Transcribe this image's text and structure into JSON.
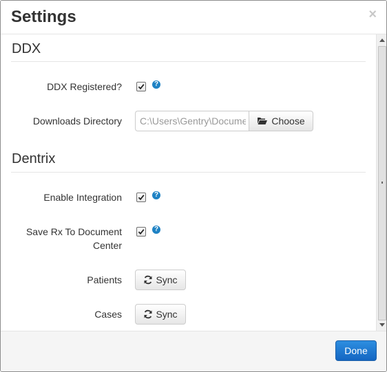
{
  "dialog": {
    "title": "Settings",
    "close_symbol": "×"
  },
  "sections": {
    "ddx": {
      "title": "DDX",
      "registered_label": "DDX Registered?",
      "registered_checked": true,
      "downloads_label": "Downloads Directory",
      "downloads_value": "C:\\Users\\Gentry\\Documents",
      "choose_label": "Choose"
    },
    "dentrix": {
      "title": "Dentrix",
      "enable_label": "Enable Integration",
      "enable_checked": true,
      "save_rx_label_line1": "Save Rx To Document",
      "save_rx_label_line2": "Center",
      "save_rx_checked": true,
      "patients_label": "Patients",
      "patients_sync_label": "Sync",
      "cases_label": "Cases",
      "cases_sync_label": "Sync"
    }
  },
  "help_symbol": "?",
  "footer": {
    "done_label": "Done"
  },
  "icons": {
    "help": "help-icon",
    "folder": "folder-open-icon",
    "sync": "refresh-icon",
    "close": "close-icon"
  },
  "colors": {
    "primary": "#1466c2",
    "help": "#1e82c4",
    "footer_bg": "#f5f5f5"
  }
}
